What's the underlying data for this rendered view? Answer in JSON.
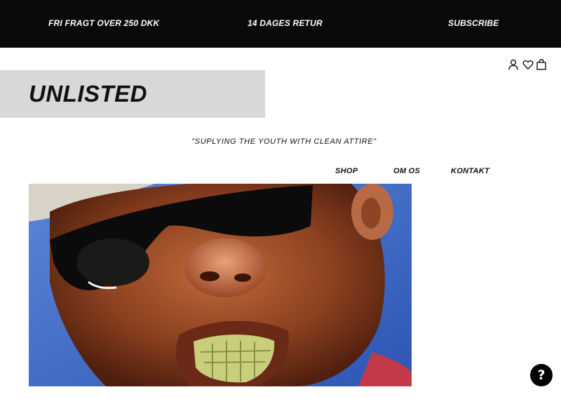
{
  "announcement_bar": {
    "items": [
      "FRI FRAGT OVER 250 DKK",
      "14 DAGES RETUR",
      "SUBSCRIBE"
    ]
  },
  "header": {
    "icons": [
      "user-icon",
      "heart-icon",
      "shopping-bag-icon"
    ]
  },
  "logo": {
    "text": "UNLISTED"
  },
  "tagline": "\"SUPLYING THE YOUTH WITH CLEAN ATTIRE\"",
  "nav": {
    "items": [
      "SHOP",
      "OM OS",
      "KONTAKT"
    ]
  },
  "help_button": {
    "label": "?"
  },
  "colors": {
    "topbar_bg": "#0a0a0a",
    "logo_bg": "#d8d8d8",
    "text": "#111111"
  }
}
